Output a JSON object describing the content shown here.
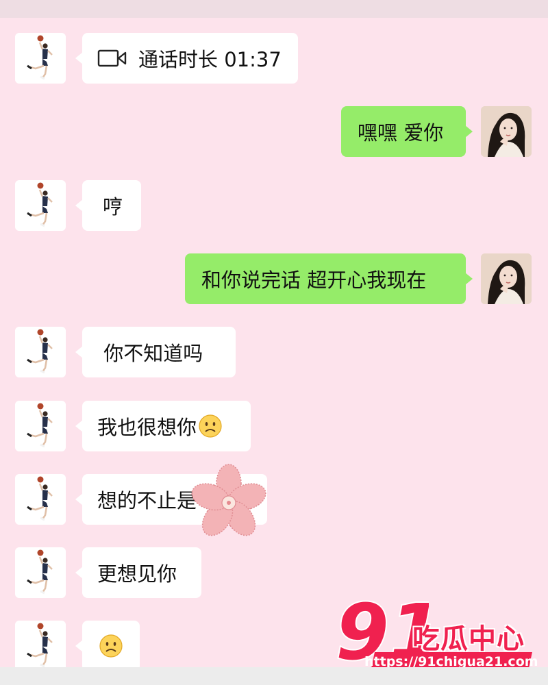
{
  "messages": [
    {
      "side": "left",
      "type": "call",
      "icon": "video-call-icon",
      "text": "通话时长 01:37"
    },
    {
      "side": "right",
      "text": "嘿嘿 爱你"
    },
    {
      "side": "left",
      "text": "哼"
    },
    {
      "side": "right",
      "text": "和你说完话 超开心我现在"
    },
    {
      "side": "left",
      "text": " 你不知道吗"
    },
    {
      "side": "left",
      "text": "我也很想你",
      "emoji": "sad-face-emoji"
    },
    {
      "side": "left",
      "text": "想的不止是"
    },
    {
      "side": "left",
      "text": "更想见你"
    },
    {
      "side": "left",
      "text": "",
      "emoji": "sad-face-emoji"
    }
  ],
  "watermark": {
    "number": "91",
    "name": "吃瓜中心",
    "url": "https://91chigua21.com"
  },
  "colors": {
    "background": "#fde3ec",
    "sent_bubble": "#95ec69",
    "received_bubble": "#ffffff",
    "watermark": "#f0214f"
  }
}
